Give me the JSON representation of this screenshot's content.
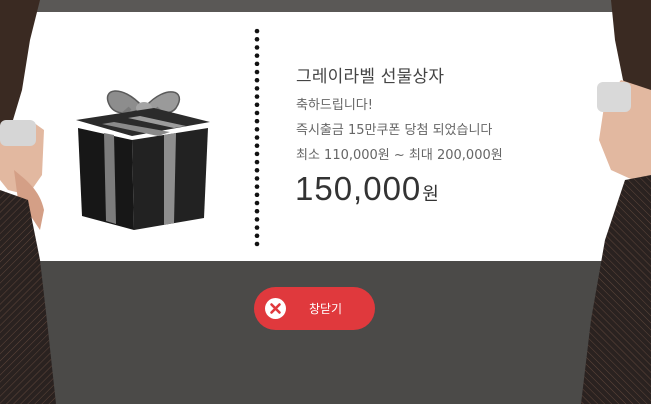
{
  "popup": {
    "title": "그레이라벨 선물상자",
    "line1": "축하드립니다!",
    "line2": "즉시출금 15만쿠폰 당첨 되었습니다",
    "line3": "최소 110,000원 ~ 최대 200,000원",
    "amount_value": "150,000",
    "amount_unit": "원"
  },
  "close_button": {
    "label": "창닫기"
  },
  "colors": {
    "accent": "#e0393d",
    "card": "#ffffff",
    "backdrop": "#4b4a48"
  }
}
